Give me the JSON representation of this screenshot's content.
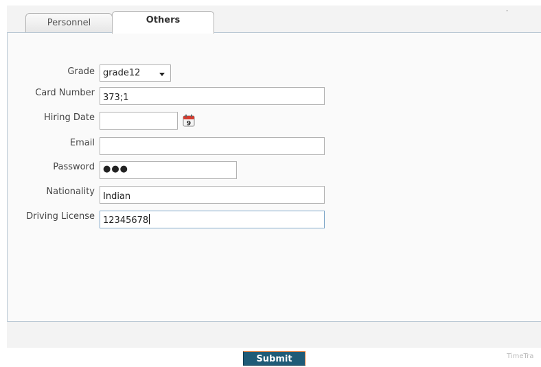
{
  "tabs": [
    {
      "label": "Personnel",
      "active": false
    },
    {
      "label": "Others",
      "active": true
    }
  ],
  "header": {
    "dash": "-"
  },
  "form": {
    "grade": {
      "label": "Grade",
      "value": "grade12"
    },
    "card_number": {
      "label": "Card Number",
      "value": "373;1"
    },
    "hiring_date": {
      "label": "Hiring Date",
      "value": "",
      "calendar_icon_text": "9"
    },
    "email": {
      "label": "Email",
      "value": ""
    },
    "password": {
      "label": "Password",
      "value": "●●●"
    },
    "nationality": {
      "label": "Nationality",
      "value": "Indian"
    },
    "driving_license": {
      "label": "Driving License",
      "value": "12345678"
    }
  },
  "submit": {
    "label": "Submit"
  },
  "brand": {
    "text": "TimeTra"
  },
  "colors": {
    "submit_bg": "#1f5b77",
    "panel_border": "#b8c7d3",
    "calendar_red": "#d63b2f"
  }
}
